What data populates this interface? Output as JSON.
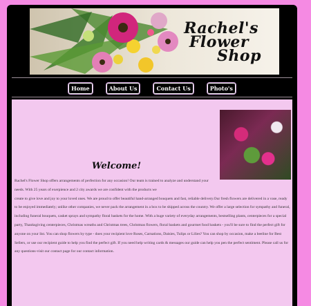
{
  "header": {
    "logo_line1": "Rachel's",
    "logo_line2": "Flower",
    "logo_line3": "Shop"
  },
  "nav": {
    "items": [
      {
        "label": "Home"
      },
      {
        "label": "About Us"
      },
      {
        "label": "Contact Us"
      },
      {
        "label": "Photo's"
      }
    ]
  },
  "main": {
    "heading": "Welcome!",
    "paragraph_narrow": "Rachel's Flower Shop offers arrangements of perfection for any occasion! Our team is trained to analyze and understand your needs. With 25 years of exerpience and 2 city awards we are confident with the products we",
    "paragraph_wide": "create to give love and joy to your loved ones. We are proud to offer beautiful hand-arranged bouquets and fast, reliable delivery.Our fresh flowers are delivered in a vase, ready to be enjoyed immediately; unlike other companies, we never pack the arrangement in a box to be shipped across the country. We offer a large selection for sympathy and funeral, including funeral bouquets, casket sprays and sympathy floral baskets for the home. With a huge variety of everyday arrangements, bestselling plants, centerpieces for a special party, Thanksgiving centerpieces, Christmas wreaths and Christmas trees, Christmas flowers, floral baskets and gourmet food baskets - you'll be sure to find the perfect gift for anyone on your list. You can shop flowers by type - does your recipient love Roses, Carnations, Daisies, Tulips or Lilies? You can shop by occasion, make a beeline for Best Sellers, or use our recipient guide to help you find the perfect gift. If you need help writing cards & messages our guide can help you pen the perfect sentiment. Please call us for any questions-visit our contact page for our contact information."
  }
}
